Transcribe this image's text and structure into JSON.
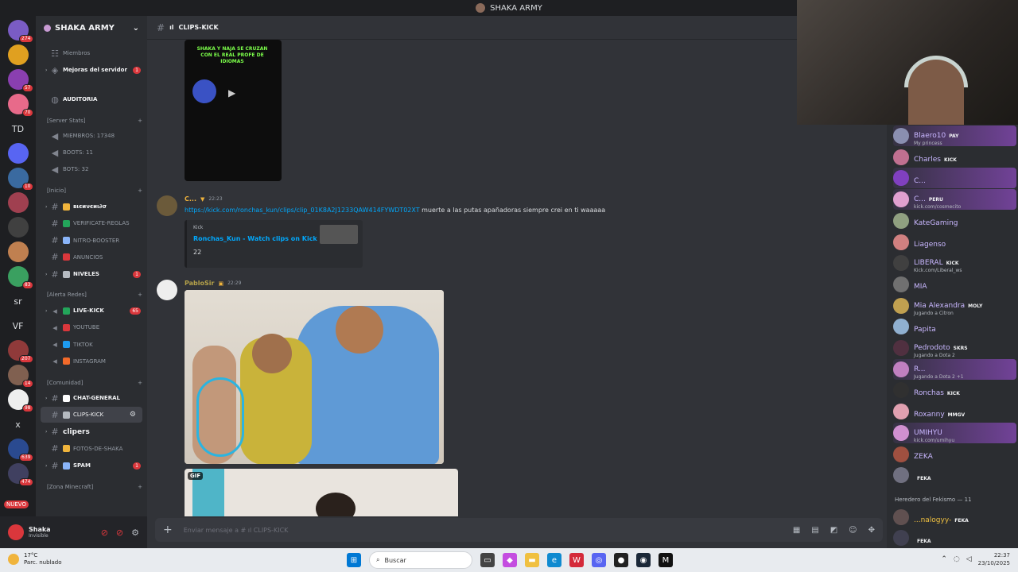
{
  "window": {
    "title": "SHAKA ARMY"
  },
  "colors": {
    "accent": "#5865f2",
    "link": "#00a8fc",
    "badge": "#da373c",
    "online": "#23a55a"
  },
  "rail": {
    "servers": [
      {
        "badge": "274",
        "color": "#7a5cc4"
      },
      {
        "badge": "",
        "color": "#e0a020"
      },
      {
        "badge": "57",
        "color": "#8a3fb0"
      },
      {
        "badge": "70",
        "color": "#e86a8a"
      },
      {
        "label": "TD",
        "badge": ""
      },
      {
        "badge": "",
        "color": "#5865f2"
      },
      {
        "badge": "10",
        "color": "#3a6aa0"
      },
      {
        "badge": "",
        "color": "#a04050"
      },
      {
        "badge": "",
        "color": "#404040"
      },
      {
        "badge": "",
        "color": "#c08050"
      },
      {
        "badge": "83",
        "color": "#3aa060"
      },
      {
        "label": "sr",
        "badge": ""
      },
      {
        "label": "VF",
        "badge": ""
      },
      {
        "badge": "207",
        "color": "#903a3a"
      },
      {
        "badge": "14",
        "color": "#806050"
      },
      {
        "badge": "98",
        "color": "#eeeeee"
      },
      {
        "label": "x",
        "badge": ""
      },
      {
        "badge": "639",
        "color": "#2a4a90"
      },
      {
        "badge": "474",
        "color": "#404060"
      }
    ],
    "new_label": "NUEVO"
  },
  "sidebar": {
    "server_name": "SHAKA ARMY",
    "top_items": [
      {
        "label": "Miembros"
      },
      {
        "label": "Mejoras del servidor",
        "count": "1"
      }
    ],
    "auditoria": "AUDITORIA",
    "cat_stats": "[Server Stats]",
    "stats": [
      "MIEMBROS: 17348",
      "BOOTS: 11",
      "BOTS: 32"
    ],
    "cat_inicio": "[Inicio]",
    "inicio": [
      {
        "label": "вιєиνєиι∂σ",
        "bright": true,
        "emo": "#f0b43c"
      },
      {
        "label": "VERIFICATE-REGLAS",
        "emo": "#23a55a"
      },
      {
        "label": "NITRO-BOOSTER",
        "emo": "#8ab4f8"
      },
      {
        "label": "ANUNCIOS",
        "emo": "#da373c"
      },
      {
        "label": "NIVELES",
        "bright": true,
        "count": "1",
        "emo": "#b5bac1"
      }
    ],
    "cat_alerta": "[Alerta Redes]",
    "alerta": [
      {
        "label": "LIVE-KICK",
        "bright": true,
        "count": "65",
        "emo": "#23a55a"
      },
      {
        "label": "YOUTUBE",
        "emo": "#da373c"
      },
      {
        "label": "TIKTOK",
        "emo": "#1d9bf0"
      },
      {
        "label": "INSTAGRAM",
        "emo": "#f26a2a"
      }
    ],
    "cat_comunidad": "[Comunidad]",
    "comunidad": [
      {
        "label": "CHAT-GENERAL",
        "bright": true,
        "emo": "#ffffff"
      },
      {
        "label": "CLIPS-KICK",
        "active": true,
        "emo": "#b5bac1"
      },
      {
        "label": "clipers",
        "bright": true,
        "big": true,
        "emo": ""
      },
      {
        "label": "FOTOS-DE-SHAKA",
        "emo": "#f0b43c"
      },
      {
        "label": "SPAM",
        "bright": true,
        "count": "1",
        "emo": "#8ab4f8"
      }
    ],
    "cat_minecraft": "[Zona Minecraft]"
  },
  "user": {
    "name": "Shaka",
    "status": "Invisible"
  },
  "channel": {
    "name": "CLIPS-KICK",
    "prefix": "ıl"
  },
  "messages": {
    "video_caption": "SHAKA Y NAJA SE CRUZAN CON EL REAL PROFE DE IDIOMAS",
    "m1": {
      "author": "C...",
      "time": "22:23",
      "link": "https://kick.com/ronchas_kun/clips/clip_01K8A2J1233QAW414FYWDT02XT",
      "text": " muerte a las putas apañadoras siempre crei en ti waaaaa",
      "embed": {
        "provider": "Kick",
        "title": "Ronchas_Kun - Watch clips on Kick",
        "desc": "22"
      }
    },
    "m2": {
      "author": "PabloSir",
      "time": "22:29"
    },
    "gif_label": "GIF"
  },
  "composer": {
    "placeholder": "Enviar mensaje a #  ıl CLIPS-KICK"
  },
  "members": [
    {
      "name": "Blaero10",
      "tag": "PAY",
      "sub": "My princess",
      "color": "#c9b7ff",
      "av": "#8a8fb0",
      "hl": true
    },
    {
      "name": "Charles",
      "tag": "KICK",
      "sub": "",
      "color": "#c9b7ff",
      "av": "#c07090"
    },
    {
      "name": "C...",
      "tag": "",
      "sub": "",
      "color": "#c9b7ff",
      "av": "#8040c0",
      "hl": true
    },
    {
      "name": "C...",
      "tag": "PERU",
      "sub": "kick.com/cosmecito",
      "color": "#c9b7ff",
      "av": "#e0a0d0",
      "hl": true
    },
    {
      "name": "KateGaming",
      "tag": "",
      "sub": "",
      "color": "#c9b7ff",
      "av": "#90a080"
    },
    {
      "name": "Liagenso",
      "tag": "",
      "sub": "",
      "color": "#c9b7ff",
      "av": "#d08080"
    },
    {
      "name": "LIBERAL",
      "tag": "KICK",
      "sub": "Kick.com/Liberal_ws",
      "color": "#c9b7ff",
      "av": "#404040"
    },
    {
      "name": "MIA",
      "tag": "",
      "sub": "",
      "color": "#c9b7ff",
      "av": "#707070"
    },
    {
      "name": "Mia Alexandra",
      "tag": "MOLY",
      "sub": "Jugando a Citron",
      "color": "#c9b7ff",
      "av": "#c0a050"
    },
    {
      "name": "Papita",
      "tag": "",
      "sub": "",
      "color": "#c9b7ff",
      "av": "#90b0d0"
    },
    {
      "name": "Pedrodoto",
      "tag": "SKRS",
      "sub": "Jugando a Dota 2",
      "color": "#c9b7ff",
      "av": "#503040"
    },
    {
      "name": "R...",
      "tag": "",
      "sub": "Jugando a Dota 2 +1",
      "color": "#c9b7ff",
      "av": "#c080c0",
      "hl": true
    },
    {
      "name": "Ronchas",
      "tag": "KICK",
      "sub": "",
      "color": "#c9b7ff",
      "av": "#303030"
    },
    {
      "name": "Roxanny",
      "tag": "MMGV",
      "sub": "",
      "color": "#c9b7ff",
      "av": "#e0a0b0"
    },
    {
      "name": "UMIHYU",
      "tag": "",
      "sub": "kick.com/umihyu",
      "color": "#c9b7ff",
      "av": "#d090d0",
      "hl": true
    },
    {
      "name": "ZEKA",
      "tag": "",
      "sub": "",
      "color": "#c9b7ff",
      "av": "#a05040"
    },
    {
      "name": "",
      "tag": "FEKA",
      "sub": "",
      "color": "#c9b7ff",
      "av": "#707080"
    }
  ],
  "member_group": "Heredero del Fekismo — 11",
  "members2": [
    {
      "name": "...nalogyy-",
      "tag": "FEKA",
      "sub": "",
      "color": "#f0c040",
      "av": "#605050"
    },
    {
      "name": "",
      "tag": "FEKA",
      "sub": "",
      "color": "#c9b7ff",
      "av": "#404050"
    }
  ],
  "taskbar": {
    "temp": "17°C",
    "weather": "Parc. nublado",
    "search": "Buscar",
    "time": "22:37",
    "date": "23/10/2025"
  }
}
